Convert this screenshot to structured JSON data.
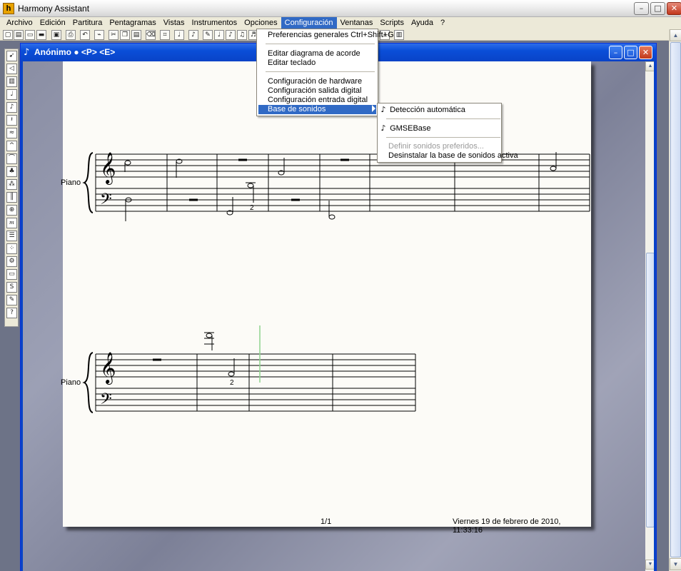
{
  "app": {
    "title": "Harmony Assistant",
    "icon_letter": "h"
  },
  "window_controls": {
    "minimize": "–",
    "maximize": "□",
    "close": "✕"
  },
  "menubar": [
    {
      "label": "Archivo"
    },
    {
      "label": "Edición"
    },
    {
      "label": "Partitura"
    },
    {
      "label": "Pentagramas"
    },
    {
      "label": "Vistas"
    },
    {
      "label": "Instrumentos"
    },
    {
      "label": "Opciones"
    },
    {
      "label": "Configuración"
    },
    {
      "label": "Ventanas"
    },
    {
      "label": "Scripts"
    },
    {
      "label": "Ayuda"
    },
    {
      "label": "?"
    }
  ],
  "config_menu": {
    "items": [
      {
        "label": "Preferencias generales Ctrl+Shift+G"
      },
      {
        "label": "Editar diagrama de acorde"
      },
      {
        "label": "Editar teclado"
      },
      {
        "label": "Configuración de hardware"
      },
      {
        "label": "Configuración salida digital"
      },
      {
        "label": "Configuración entrada digital"
      },
      {
        "label": "Base de sonidos"
      }
    ]
  },
  "sound_submenu": {
    "items": [
      {
        "label": "Detección automática",
        "check": "♪"
      },
      {
        "label": "GMSEBase",
        "check": "♪"
      },
      {
        "label": "Definir sonidos preferidos..."
      },
      {
        "label": "Desinstalar la base de sonidos activa"
      }
    ]
  },
  "document": {
    "title": "Anónimo ● <P> <E>",
    "icon": "♪"
  },
  "score": {
    "system1_label": "Piano",
    "system2_label": "Piano",
    "fingering1": "2",
    "fingering2": "2",
    "page_number": "1/1",
    "timestamp": "Viernes 19 de febrero de 2010, 11:33:16"
  },
  "toolbar_icons": [
    "new-icon",
    "open-icon",
    "folder-icon",
    "save-icon",
    "print-icon",
    "undo-icon",
    "cut-icon",
    "copy-icon",
    "paste-icon",
    "note-icon",
    "note-icon",
    "note-icon",
    "note-icon",
    "note-icon",
    "note-icon",
    "note-icon",
    "mixer-icon",
    "piano-icon"
  ],
  "palette_icons": [
    "cursor-icon",
    "speaker-icon",
    "keyboard-icon",
    "note-icon",
    "eighth-note-icon",
    "rest-icon",
    "dynamics-icon",
    "slur-icon",
    "accent-icon",
    "chord-icon",
    "tuplet-icon",
    "measure-icon",
    "tempo-icon",
    "mp-icon",
    "lyrics-icon",
    "grid-icon",
    "gear-icon",
    "bar-icon",
    "s-icon",
    "pen-icon",
    "help-icon"
  ]
}
